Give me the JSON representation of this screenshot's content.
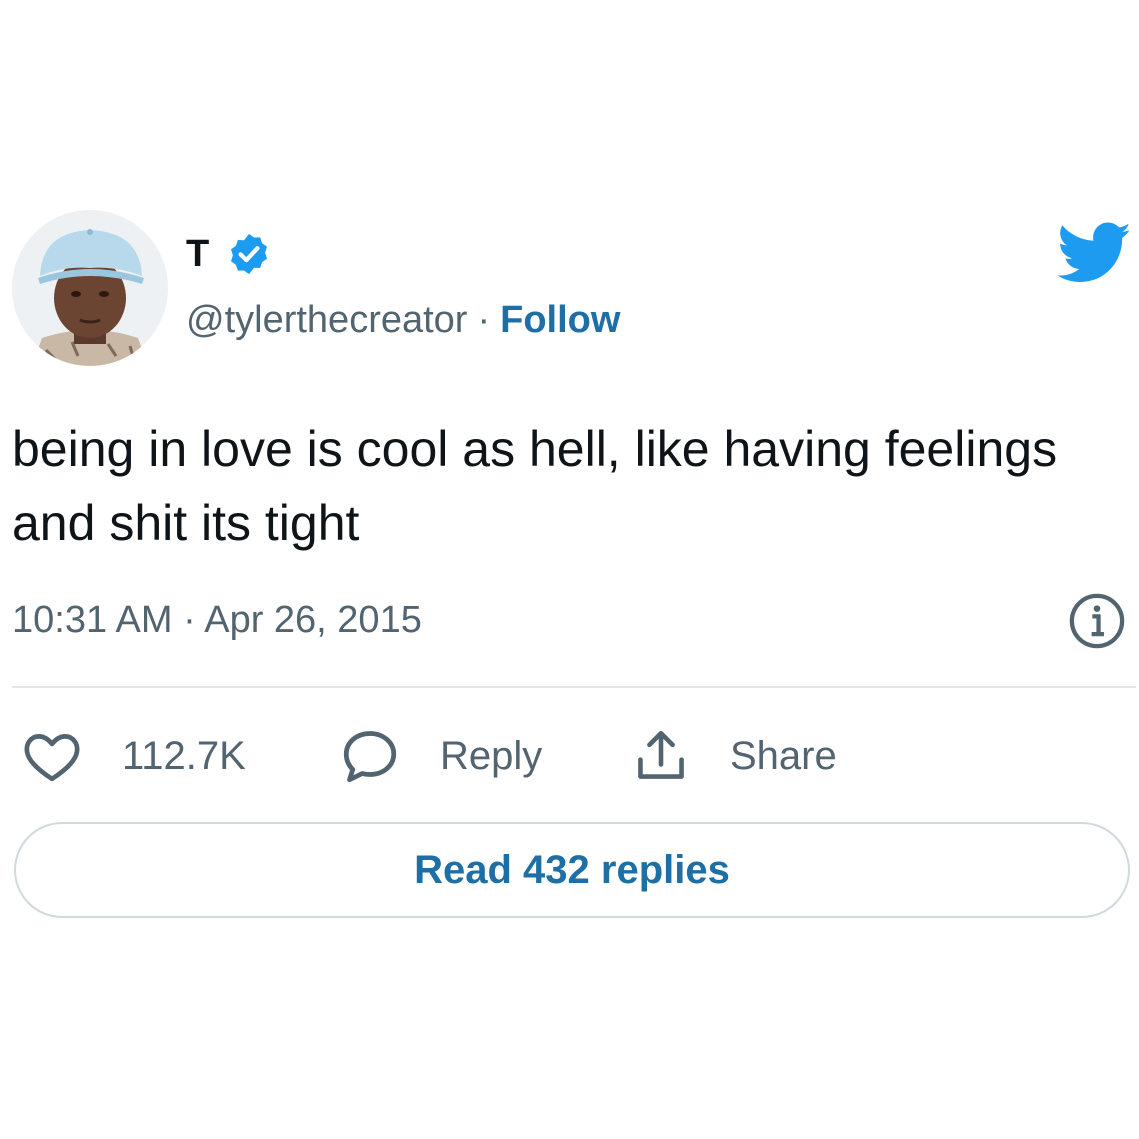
{
  "author": {
    "display_name": "T",
    "handle": "@tylerthecreator",
    "separator": "·",
    "follow_label": "Follow"
  },
  "icons": {
    "verified": "verified-badge-icon",
    "brand": "twitter-bird-icon",
    "info": "info-icon",
    "like": "heart-icon",
    "reply": "speech-bubble-icon",
    "share": "share-icon"
  },
  "colors": {
    "brand_blue": "#1d9bf0",
    "link_blue": "#1d6fa5",
    "text": "#0f1419",
    "muted": "#536471"
  },
  "tweet": {
    "text": "being in love is cool as hell, like having feelings and shit its tight",
    "timestamp": "10:31 AM · Apr 26, 2015"
  },
  "actions": {
    "like_count": "112.7K",
    "reply_label": "Reply",
    "share_label": "Share"
  },
  "replies_button": {
    "label": "Read 432 replies"
  }
}
